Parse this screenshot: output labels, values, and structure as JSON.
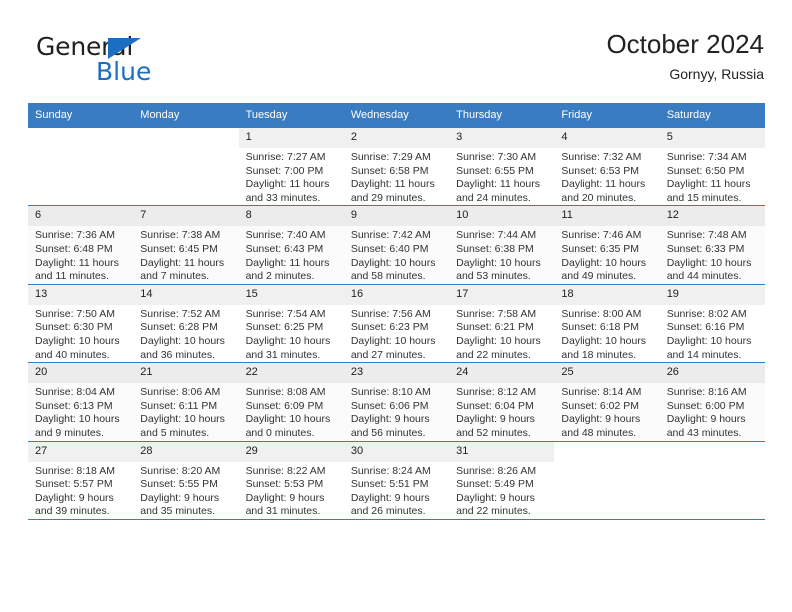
{
  "brand": {
    "word1": "General",
    "word2": "Blue",
    "accent_color": "#1b6ec2"
  },
  "header": {
    "title": "October 2024",
    "subtitle": "Gornyy, Russia"
  },
  "calendar": {
    "header_color": "#3a7cc1",
    "weekday_headers": [
      "Sunday",
      "Monday",
      "Tuesday",
      "Wednesday",
      "Thursday",
      "Friday",
      "Saturday"
    ],
    "weeks": [
      [
        {
          "day": "",
          "sunrise": "",
          "sunset": "",
          "daylight_line1": "",
          "daylight_line2": ""
        },
        {
          "day": "",
          "sunrise": "",
          "sunset": "",
          "daylight_line1": "",
          "daylight_line2": ""
        },
        {
          "day": "1",
          "sunrise": "Sunrise: 7:27 AM",
          "sunset": "Sunset: 7:00 PM",
          "daylight_line1": "Daylight: 11 hours",
          "daylight_line2": "and 33 minutes."
        },
        {
          "day": "2",
          "sunrise": "Sunrise: 7:29 AM",
          "sunset": "Sunset: 6:58 PM",
          "daylight_line1": "Daylight: 11 hours",
          "daylight_line2": "and 29 minutes."
        },
        {
          "day": "3",
          "sunrise": "Sunrise: 7:30 AM",
          "sunset": "Sunset: 6:55 PM",
          "daylight_line1": "Daylight: 11 hours",
          "daylight_line2": "and 24 minutes."
        },
        {
          "day": "4",
          "sunrise": "Sunrise: 7:32 AM",
          "sunset": "Sunset: 6:53 PM",
          "daylight_line1": "Daylight: 11 hours",
          "daylight_line2": "and 20 minutes."
        },
        {
          "day": "5",
          "sunrise": "Sunrise: 7:34 AM",
          "sunset": "Sunset: 6:50 PM",
          "daylight_line1": "Daylight: 11 hours",
          "daylight_line2": "and 15 minutes."
        }
      ],
      [
        {
          "day": "6",
          "sunrise": "Sunrise: 7:36 AM",
          "sunset": "Sunset: 6:48 PM",
          "daylight_line1": "Daylight: 11 hours",
          "daylight_line2": "and 11 minutes."
        },
        {
          "day": "7",
          "sunrise": "Sunrise: 7:38 AM",
          "sunset": "Sunset: 6:45 PM",
          "daylight_line1": "Daylight: 11 hours",
          "daylight_line2": "and 7 minutes."
        },
        {
          "day": "8",
          "sunrise": "Sunrise: 7:40 AM",
          "sunset": "Sunset: 6:43 PM",
          "daylight_line1": "Daylight: 11 hours",
          "daylight_line2": "and 2 minutes."
        },
        {
          "day": "9",
          "sunrise": "Sunrise: 7:42 AM",
          "sunset": "Sunset: 6:40 PM",
          "daylight_line1": "Daylight: 10 hours",
          "daylight_line2": "and 58 minutes."
        },
        {
          "day": "10",
          "sunrise": "Sunrise: 7:44 AM",
          "sunset": "Sunset: 6:38 PM",
          "daylight_line1": "Daylight: 10 hours",
          "daylight_line2": "and 53 minutes."
        },
        {
          "day": "11",
          "sunrise": "Sunrise: 7:46 AM",
          "sunset": "Sunset: 6:35 PM",
          "daylight_line1": "Daylight: 10 hours",
          "daylight_line2": "and 49 minutes."
        },
        {
          "day": "12",
          "sunrise": "Sunrise: 7:48 AM",
          "sunset": "Sunset: 6:33 PM",
          "daylight_line1": "Daylight: 10 hours",
          "daylight_line2": "and 44 minutes."
        }
      ],
      [
        {
          "day": "13",
          "sunrise": "Sunrise: 7:50 AM",
          "sunset": "Sunset: 6:30 PM",
          "daylight_line1": "Daylight: 10 hours",
          "daylight_line2": "and 40 minutes."
        },
        {
          "day": "14",
          "sunrise": "Sunrise: 7:52 AM",
          "sunset": "Sunset: 6:28 PM",
          "daylight_line1": "Daylight: 10 hours",
          "daylight_line2": "and 36 minutes."
        },
        {
          "day": "15",
          "sunrise": "Sunrise: 7:54 AM",
          "sunset": "Sunset: 6:25 PM",
          "daylight_line1": "Daylight: 10 hours",
          "daylight_line2": "and 31 minutes."
        },
        {
          "day": "16",
          "sunrise": "Sunrise: 7:56 AM",
          "sunset": "Sunset: 6:23 PM",
          "daylight_line1": "Daylight: 10 hours",
          "daylight_line2": "and 27 minutes."
        },
        {
          "day": "17",
          "sunrise": "Sunrise: 7:58 AM",
          "sunset": "Sunset: 6:21 PM",
          "daylight_line1": "Daylight: 10 hours",
          "daylight_line2": "and 22 minutes."
        },
        {
          "day": "18",
          "sunrise": "Sunrise: 8:00 AM",
          "sunset": "Sunset: 6:18 PM",
          "daylight_line1": "Daylight: 10 hours",
          "daylight_line2": "and 18 minutes."
        },
        {
          "day": "19",
          "sunrise": "Sunrise: 8:02 AM",
          "sunset": "Sunset: 6:16 PM",
          "daylight_line1": "Daylight: 10 hours",
          "daylight_line2": "and 14 minutes."
        }
      ],
      [
        {
          "day": "20",
          "sunrise": "Sunrise: 8:04 AM",
          "sunset": "Sunset: 6:13 PM",
          "daylight_line1": "Daylight: 10 hours",
          "daylight_line2": "and 9 minutes."
        },
        {
          "day": "21",
          "sunrise": "Sunrise: 8:06 AM",
          "sunset": "Sunset: 6:11 PM",
          "daylight_line1": "Daylight: 10 hours",
          "daylight_line2": "and 5 minutes."
        },
        {
          "day": "22",
          "sunrise": "Sunrise: 8:08 AM",
          "sunset": "Sunset: 6:09 PM",
          "daylight_line1": "Daylight: 10 hours",
          "daylight_line2": "and 0 minutes."
        },
        {
          "day": "23",
          "sunrise": "Sunrise: 8:10 AM",
          "sunset": "Sunset: 6:06 PM",
          "daylight_line1": "Daylight: 9 hours",
          "daylight_line2": "and 56 minutes."
        },
        {
          "day": "24",
          "sunrise": "Sunrise: 8:12 AM",
          "sunset": "Sunset: 6:04 PM",
          "daylight_line1": "Daylight: 9 hours",
          "daylight_line2": "and 52 minutes."
        },
        {
          "day": "25",
          "sunrise": "Sunrise: 8:14 AM",
          "sunset": "Sunset: 6:02 PM",
          "daylight_line1": "Daylight: 9 hours",
          "daylight_line2": "and 48 minutes."
        },
        {
          "day": "26",
          "sunrise": "Sunrise: 8:16 AM",
          "sunset": "Sunset: 6:00 PM",
          "daylight_line1": "Daylight: 9 hours",
          "daylight_line2": "and 43 minutes."
        }
      ],
      [
        {
          "day": "27",
          "sunrise": "Sunrise: 8:18 AM",
          "sunset": "Sunset: 5:57 PM",
          "daylight_line1": "Daylight: 9 hours",
          "daylight_line2": "and 39 minutes."
        },
        {
          "day": "28",
          "sunrise": "Sunrise: 8:20 AM",
          "sunset": "Sunset: 5:55 PM",
          "daylight_line1": "Daylight: 9 hours",
          "daylight_line2": "and 35 minutes."
        },
        {
          "day": "29",
          "sunrise": "Sunrise: 8:22 AM",
          "sunset": "Sunset: 5:53 PM",
          "daylight_line1": "Daylight: 9 hours",
          "daylight_line2": "and 31 minutes."
        },
        {
          "day": "30",
          "sunrise": "Sunrise: 8:24 AM",
          "sunset": "Sunset: 5:51 PM",
          "daylight_line1": "Daylight: 9 hours",
          "daylight_line2": "and 26 minutes."
        },
        {
          "day": "31",
          "sunrise": "Sunrise: 8:26 AM",
          "sunset": "Sunset: 5:49 PM",
          "daylight_line1": "Daylight: 9 hours",
          "daylight_line2": "and 22 minutes."
        },
        {
          "day": "",
          "sunrise": "",
          "sunset": "",
          "daylight_line1": "",
          "daylight_line2": ""
        },
        {
          "day": "",
          "sunrise": "",
          "sunset": "",
          "daylight_line1": "",
          "daylight_line2": ""
        }
      ]
    ]
  }
}
